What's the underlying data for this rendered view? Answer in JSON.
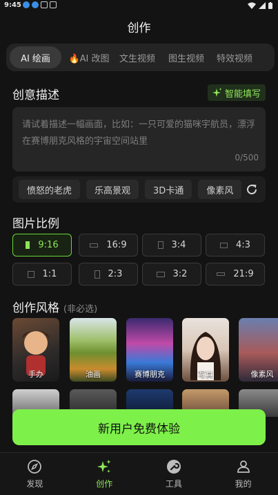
{
  "status": {
    "time": "9:45"
  },
  "header": {
    "title": "创作"
  },
  "tabs": [
    {
      "label": "AI 绘画",
      "active": true
    },
    {
      "label": "🔥AI 改图"
    },
    {
      "label": "文生视频"
    },
    {
      "label": "图生视频"
    },
    {
      "label": "特效视频"
    }
  ],
  "prompt": {
    "title": "创意描述",
    "smart_fill": "智能填写",
    "placeholder": "请试着描述一幅画面，比如：一只可爱的猫咪宇航员，漂浮在赛博朋克风格的宇宙空间站里",
    "count": "0/500"
  },
  "chips": [
    "愤怒的老虎",
    "乐高景观",
    "3D卡通",
    "像素风"
  ],
  "ratio": {
    "title": "图片比例",
    "options": [
      "9:16",
      "16:9",
      "3:4",
      "4:3",
      "1:1",
      "2:3",
      "3:2",
      "21:9"
    ],
    "selected": "9:16"
  },
  "style": {
    "title": "创作风格",
    "subtitle": "(非必选)",
    "items": [
      "手办",
      "油画",
      "赛博朋克",
      "写真",
      "像素风"
    ]
  },
  "cta": {
    "label": "新用户免费体验"
  },
  "nav": [
    {
      "label": "发现",
      "icon": "compass-icon"
    },
    {
      "label": "创作",
      "icon": "sparkle-icon",
      "active": true
    },
    {
      "label": "工具",
      "icon": "wrench-icon"
    },
    {
      "label": "我的",
      "icon": "user-icon"
    }
  ],
  "colors": {
    "accent": "#8ee65a",
    "background": "#131313",
    "cta": "#7ef04a"
  }
}
